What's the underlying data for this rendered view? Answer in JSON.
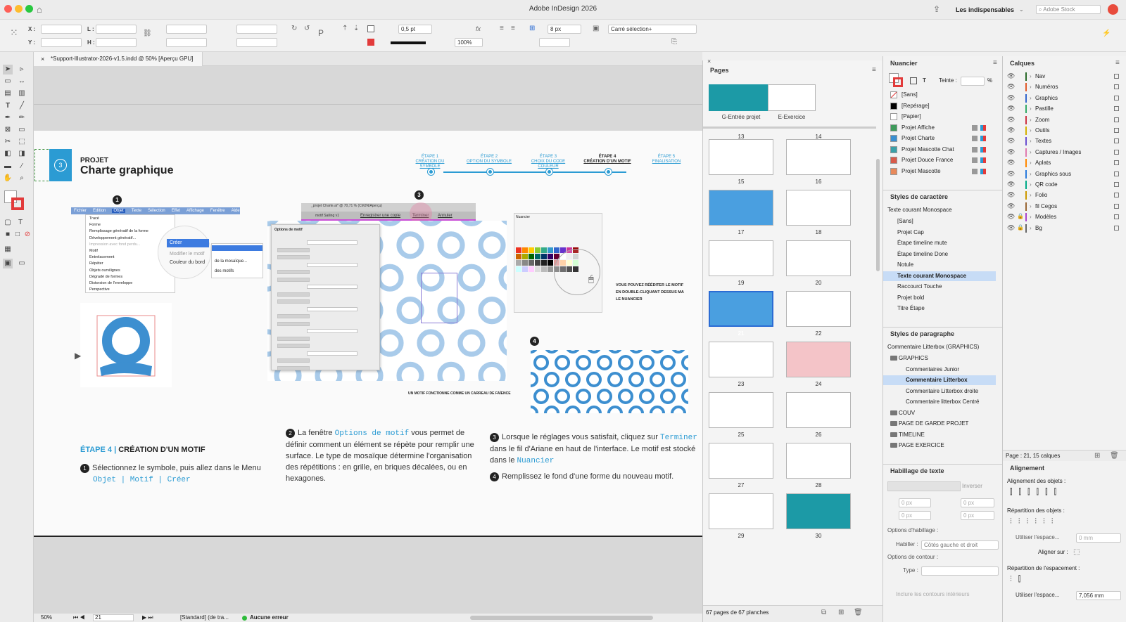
{
  "window": {
    "title": "Adobe InDesign 2026",
    "workspace": "Les indispensables",
    "stock_placeholder": "Adobe Stock"
  },
  "control": {
    "x_label": "X :",
    "y_label": "Y :",
    "w_label": "L :",
    "h_label": "H :",
    "stroke": "0,5 pt",
    "scale": "100%",
    "offset": "8 px",
    "style": "Carré sélection+"
  },
  "doc_tab": "*Support-Illustrator-2026-v1.5.indd @ 50% [Aperçu GPU]",
  "page": {
    "project_label": "PROJET",
    "project_title": "Charte graphique",
    "circle_num": "3",
    "steps": [
      {
        "a": "ÉTAPE 1",
        "b": "CRÉATION DU SYMBOLE"
      },
      {
        "a": "ÉTAPE 2",
        "b": "OPTION DU SYMBOLE"
      },
      {
        "a": "ÉTAPE 3",
        "b": "CHOIX DU CODE COULEUR"
      },
      {
        "a": "ÉTAPE 4",
        "b": "CRÉATION D'UN MOTIF"
      },
      {
        "a": "ÉTAPE 5",
        "b": "FINALISATION"
      }
    ],
    "menu_items": [
      "Fichier",
      "Edition",
      "Objet",
      "Texte",
      "Sélection",
      "Effet",
      "Affichage",
      "Fenêtre",
      "Aide"
    ],
    "objet_menu": [
      "Tracé",
      "Forme",
      "Remplissage génératif de la forme",
      "Développement génératif...",
      "Impression avec fond perdu...",
      "Motif",
      "Entrelacement",
      "Répéter",
      "Objets ourvilignes",
      "Dégradé de formes",
      "Distorsion de l'enveloppe",
      "Perspective"
    ],
    "sub_creer": "Créer",
    "sub_modifier": "Modifier le motif",
    "sub_couleur": "Couleur du bord",
    "sub_mosaique": "de la mosaïque...",
    "sub_motifs": "des motifs",
    "dialog_title": "Options de motif",
    "doc2_title": "_projet Charte.ai* @ 70,71 % (CMJN/Aperçu)",
    "save_copy": "Enregistrer une copie",
    "terminer": "Terminer",
    "annuler": "Annuler",
    "motif_name": "motif Sailing v1",
    "nuancier_label": "Nuancier",
    "note_right": "VOUS POUVEZ RÉÉDITER LE MOTIF EN DOUBLE-CLIQUANT DESSUS MA LE NUANCIER",
    "note_bottom": "UN MOTIF FONCTIONNE COMME UN CARREAU DE FAÏENCE",
    "heading_a": "ÉTAPE 4",
    "heading_b": "CRÉATION D'UN MOTIF",
    "p1": "Sélectionnez le symbole, puis allez dans le Menu",
    "p1_code": "Objet | Motif | Créer",
    "p2_a": "La fenêtre",
    "p2_code": "Options de motif",
    "p2_b": "vous permet de définir comment un élément se répète pour remplir une surface. Le type de mosaïque détermine l'organisation des répétitions : en grille, en briques décalées, ou en hexagones.",
    "p3_a": "Lorsque le réglages vous satisfait, cliquez sur",
    "p3_code": "Terminer",
    "p3_b": "dans le fil d'Ariane en haut de l'interface. Le motif est stocké dans le",
    "p3_code2": "Nuancier",
    "p4": "Remplissez le fond d'une forme du nouveau motif."
  },
  "pages_panel": {
    "title": "Pages",
    "masters": [
      {
        "name": "G-Entrée projet"
      },
      {
        "name": "E-Exercice"
      }
    ],
    "numbers": [
      "13",
      "14",
      "15",
      "16",
      "17",
      "18",
      "19",
      "20",
      "21",
      "22",
      "23",
      "24",
      "25",
      "26",
      "27",
      "28",
      "29",
      "30"
    ],
    "footer": "67 pages de 67 planches"
  },
  "nuancier": {
    "title": "Nuancier",
    "teinte_label": "Teinte :",
    "pct": "%",
    "items": [
      {
        "name": "[Sans]",
        "color": "#ffffff"
      },
      {
        "name": "[Repérage]",
        "color": "#000000"
      },
      {
        "name": "[Papier]",
        "color": "#ffffff"
      },
      {
        "name": "Projet Affiche",
        "color": "#3d9a5a"
      },
      {
        "name": "Projet Charte",
        "color": "#3a8fd1"
      },
      {
        "name": "Projet Mascotte Chat",
        "color": "#3aa0a8"
      },
      {
        "name": "Projet Douce France",
        "color": "#d85b4a"
      },
      {
        "name": "Projet Mascotte",
        "color": "#e8895a"
      }
    ]
  },
  "char_styles": {
    "title": "Styles de caractère",
    "current": "Texte courant Monospace",
    "items": [
      "[Sans]",
      "Projet Cap",
      "Étape timeline mute",
      "Étape timeline Done",
      "Notule",
      "Texte courant Monospace",
      "Raccourci Touche",
      "Projet bold",
      "Titre Étape"
    ]
  },
  "para_styles": {
    "title": "Styles de paragraphe",
    "current": "Commentaire Litterbox (GRAPHICS)",
    "items": [
      "GRAPHICS",
      "Commentaires Junior",
      "Commentaire Litterbox",
      "Commentaire Litterbox droite",
      "Commentaire litterbox Centré",
      "COUV",
      "PAGE DE GARDE PROJET",
      "TIMELINE",
      "PAGE EXERCICE"
    ]
  },
  "habillage": {
    "title": "Habillage de texte",
    "inverser": "Inverser",
    "options": "Options d'habillage :",
    "habiller_label": "Habiller :",
    "habiller_value": "Côtés gauche et droit",
    "contour": "Options de contour :",
    "type_label": "Type :",
    "inclure": "Inclure les contours intérieurs",
    "zero": "0 px"
  },
  "calques": {
    "title": "Calques",
    "items": [
      {
        "name": "Nav",
        "color": "#2a6b2a"
      },
      {
        "name": "Numéros",
        "color": "#e05a2a"
      },
      {
        "name": "Graphics",
        "color": "#3366cc"
      },
      {
        "name": "Pastille",
        "color": "#33aa66"
      },
      {
        "name": "Zoom",
        "color": "#cc3344"
      },
      {
        "name": "Outils",
        "color": "#d4b000"
      },
      {
        "name": "Textes",
        "color": "#6a4fd0"
      },
      {
        "name": "Captures / Images",
        "color": "#e07bb0"
      },
      {
        "name": "Aplats",
        "color": "#ff8800"
      },
      {
        "name": "Graphics sous",
        "color": "#2a7bdc"
      },
      {
        "name": "QR code",
        "color": "#00aa88"
      },
      {
        "name": "Folio",
        "color": "#cc9900"
      },
      {
        "name": "fil Cegos",
        "color": "#996633"
      },
      {
        "name": "Modèles",
        "color": "#aa44cc"
      },
      {
        "name": "Bg",
        "color": "#666666"
      }
    ],
    "footer": "Page : 21, 15 calques"
  },
  "alignement": {
    "title": "Alignement",
    "objets": "Alignement des objets :",
    "repartition": "Répartition des objets :",
    "utiliser": "Utiliser l'espace...",
    "zero_mm": "0 mm",
    "aligner_sur": "Aligner sur :",
    "rep_espacement": "Répartition de l'espacement :",
    "utiliser2": "Utiliser l'espace...",
    "value": "7,056 mm"
  },
  "status": {
    "zoom": "50%",
    "page": "21",
    "master": "[Standard] (de tra...",
    "errors": "Aucune erreur"
  }
}
